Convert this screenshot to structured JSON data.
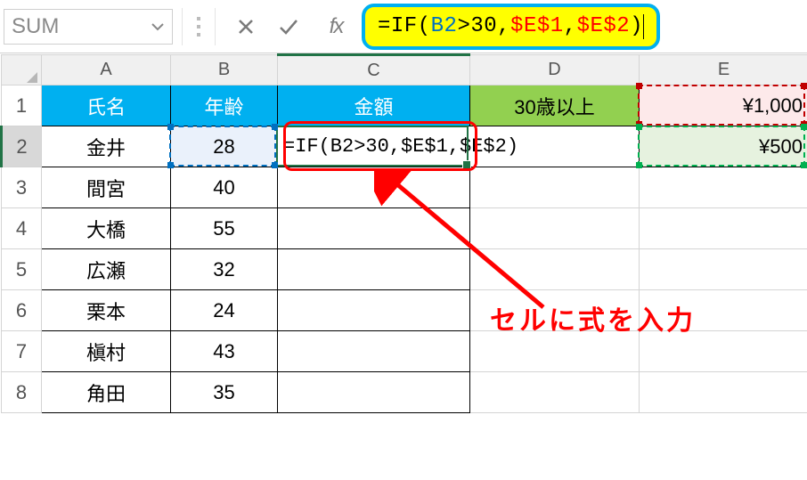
{
  "formula_bar": {
    "name_box": "SUM",
    "fx_label": "fx",
    "formula_parts": {
      "eq": "=",
      "fn": "IF",
      "open": "(",
      "arg_ref": "B2",
      "cmp": ">30,",
      "ref1": "$E$1",
      "comma": ",",
      "ref2": "$E$2",
      "close": ")"
    }
  },
  "columns": {
    "A": "A",
    "B": "B",
    "C": "C",
    "D": "D",
    "E": "E"
  },
  "row_labels": [
    "1",
    "2",
    "3",
    "4",
    "5",
    "6",
    "7",
    "8"
  ],
  "headers": {
    "A": "氏名",
    "B": "年齢",
    "C": "金額",
    "D": "30歳以上"
  },
  "valuesE": {
    "E1": "¥1,000",
    "E2": "¥500"
  },
  "people": [
    {
      "name": "金井",
      "age": "28"
    },
    {
      "name": "間宮",
      "age": "40"
    },
    {
      "name": "大橋",
      "age": "55"
    },
    {
      "name": "広瀬",
      "age": "32"
    },
    {
      "name": "栗本",
      "age": "24"
    },
    {
      "name": "槇村",
      "age": "43"
    },
    {
      "name": "角田",
      "age": "35"
    }
  ],
  "editing_text": "=IF(B2>30,$E$1,$E$2)",
  "annotation": "セルに式を入力"
}
